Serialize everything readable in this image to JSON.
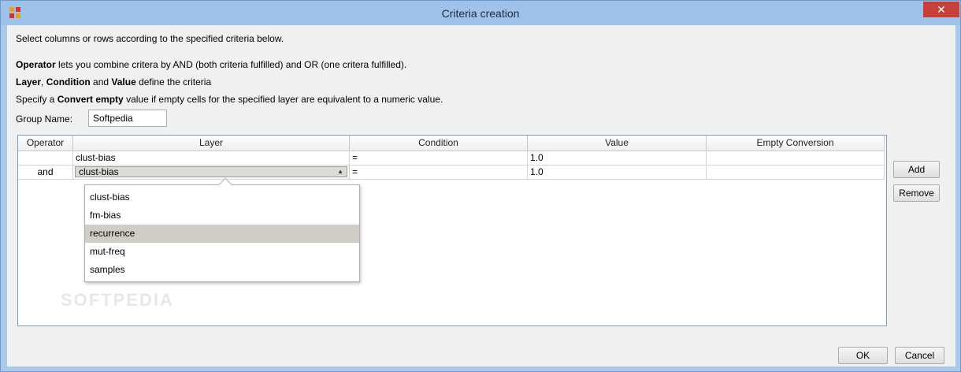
{
  "window": {
    "title": "Criteria creation",
    "close_glyph": "✕"
  },
  "intro": {
    "line1": "Select columns or rows according to the specified criteria below.",
    "l2_b1": "Operator",
    "l2_rest": " lets you combine critera by AND (both criteria fulfilled) and OR (one critera fulfilled).",
    "l3_b1": "Layer",
    "l3_t1": ", ",
    "l3_b2": "Condition",
    "l3_t2": " and ",
    "l3_b3": "Value",
    "l3_t3": " define the criteria",
    "l4_t1": "Specify a ",
    "l4_b1": "Convert empty",
    "l4_t2": " value if empty cells for the specified layer are equivalent to a numeric value."
  },
  "group": {
    "label": "Group Name:",
    "value": "Softpedia"
  },
  "table": {
    "columns": [
      "Operator",
      "Layer",
      "Condition",
      "Value",
      "Empty Conversion"
    ],
    "rows": [
      {
        "operator": "",
        "layer": "clust-bias",
        "condition": "=",
        "value": "1.0",
        "empty": ""
      },
      {
        "operator": "and",
        "layer": "clust-bias",
        "condition": "=",
        "value": "1.0",
        "empty": ""
      }
    ]
  },
  "dropdown": {
    "options": [
      "clust-bias",
      "fm-bias",
      "recurrence",
      "mut-freq",
      "samples"
    ],
    "highlighted": "recurrence"
  },
  "buttons": {
    "add": "Add",
    "remove": "Remove",
    "ok": "OK",
    "cancel": "Cancel"
  },
  "watermark": "SOFTPEDIA"
}
